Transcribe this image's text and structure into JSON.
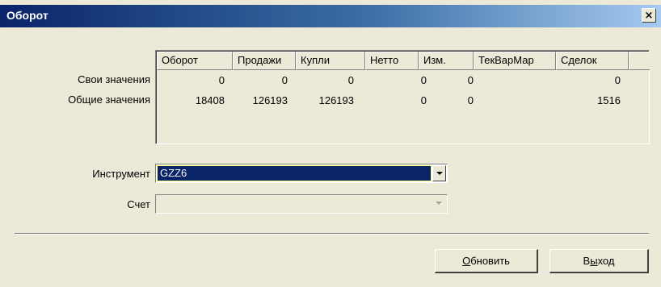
{
  "window": {
    "title": "Оборот",
    "close_glyph": "×"
  },
  "icons": {
    "close": "close-icon",
    "dropdown": "chevron-down-icon"
  },
  "table": {
    "columns": [
      "Оборот",
      "Продажи",
      "Купли",
      "Нетто",
      "Изм.",
      "ТекВарМар",
      "Сделок"
    ],
    "rows": [
      {
        "label": "Свои значения",
        "cells": [
          "0",
          "0",
          "0",
          "0",
          "0",
          "",
          "0"
        ]
      },
      {
        "label": "Общие значения",
        "cells": [
          "18408",
          "126193",
          "126193",
          "0",
          "0",
          "",
          "1516"
        ]
      }
    ]
  },
  "form": {
    "instrument_label": "Инструмент",
    "instrument_value": "GZZ6",
    "account_label": "Счет",
    "account_value": ""
  },
  "buttons": {
    "refresh_first": "О",
    "refresh_rest": "бновить",
    "exit_first": "В",
    "exit_mid": "ы",
    "exit_rest": "ход"
  }
}
